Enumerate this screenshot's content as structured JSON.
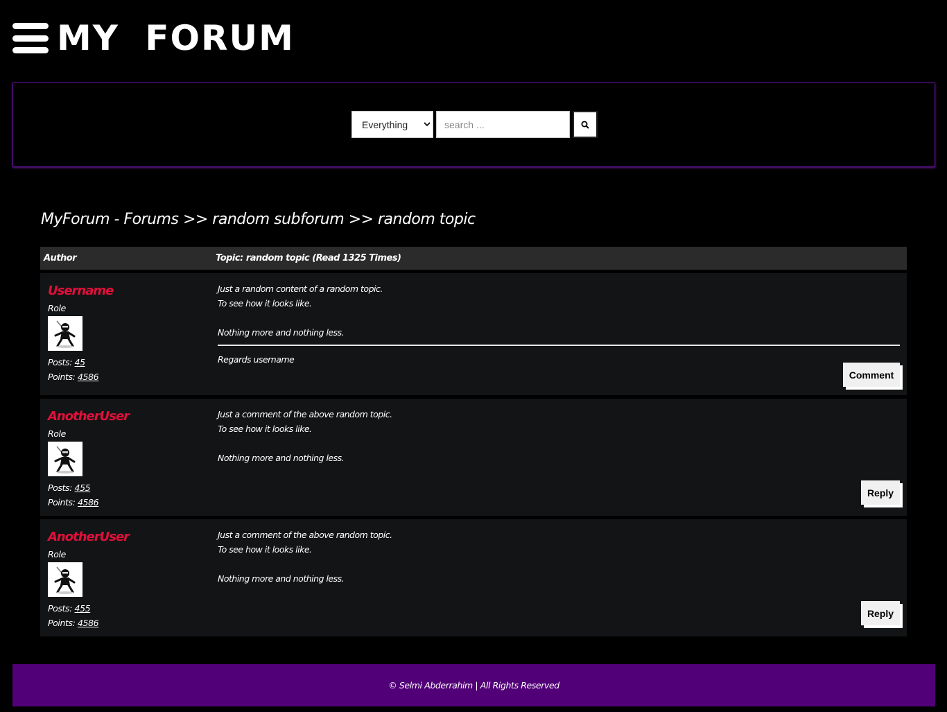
{
  "header": {
    "logo_text": "MY FORUM",
    "menu_icon": "hamburger-menu-icon"
  },
  "search": {
    "scope_selected": "Everything",
    "placeholder": "search ...",
    "button_icon": "search-icon"
  },
  "breadcrumb": "MyForum - Forums >> random subforum >> random topic",
  "table": {
    "author_header": "Author",
    "topic_header": "Topic: random topic (Read 1325 Times)"
  },
  "posts": [
    {
      "username": "Username",
      "role": "Role",
      "posts_label": "Posts:",
      "posts_value": "45",
      "points_label": "Points:",
      "points_value": "4586",
      "lines": [
        "Just a random content of a random topic.",
        "To see how it looks like.",
        "Nothing more and nothing less."
      ],
      "signature": "Regards username",
      "button": "Comment"
    },
    {
      "username": "AnotherUser",
      "role": "Role",
      "posts_label": "Posts:",
      "posts_value": "455",
      "points_label": "Points:",
      "points_value": "4586",
      "lines": [
        "Just a comment of the above random topic.",
        "To see how it looks like.",
        "Nothing more and nothing less."
      ],
      "button": "Reply"
    },
    {
      "username": "AnotherUser",
      "role": "Role",
      "posts_label": "Posts:",
      "posts_value": "455",
      "points_label": "Points:",
      "points_value": "4586",
      "lines": [
        "Just a comment of the above random topic.",
        "To see how it looks like.",
        "Nothing more and nothing less."
      ],
      "button": "Reply"
    }
  ],
  "footer": "© Selmi Abderrahim | All Rights Reserved",
  "colors": {
    "accent": "#510078",
    "username": "#e0103a",
    "panel": "#131416",
    "header_row": "#2b2b2b"
  }
}
